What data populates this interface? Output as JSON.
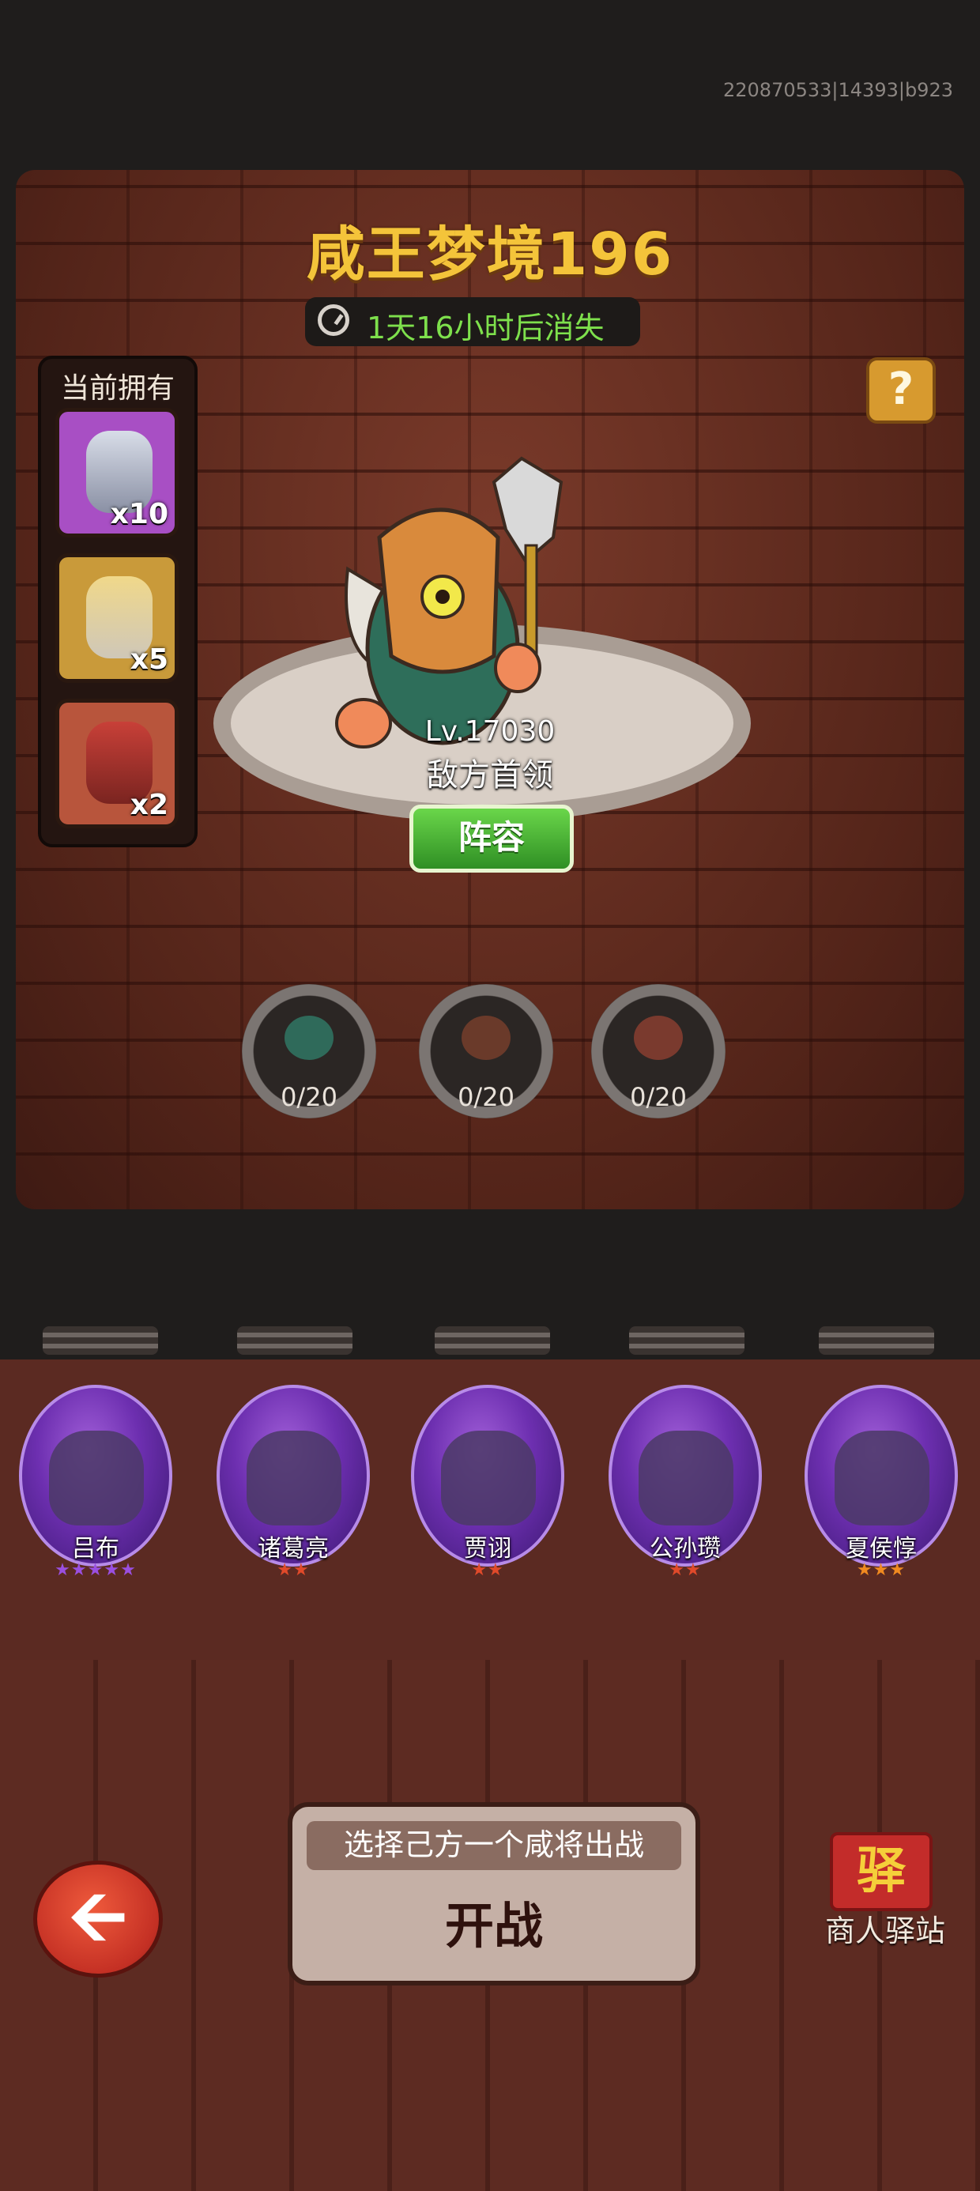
{
  "build_id": "220870533|14393|b923",
  "header": {
    "title": "咸王梦境196",
    "timer_text": "1天16小时后消失"
  },
  "help_label": "?",
  "inventory": {
    "label": "当前拥有",
    "items": [
      {
        "icon": "salt-shaker-icon",
        "qty": "x10",
        "color": "#a84fc4"
      },
      {
        "icon": "salt-sack-icon",
        "qty": "x5",
        "color": "#c99a3a"
      },
      {
        "icon": "salt-jar-icon",
        "qty": "x2",
        "color": "#b8553c"
      }
    ]
  },
  "boss": {
    "level": "Lv.17030",
    "title": "敌方首领",
    "lineup_label": "阵容"
  },
  "chambers": [
    {
      "icon": "fist-icon",
      "count": "0/20",
      "color": "#2f6a5a"
    },
    {
      "icon": "fist-icon",
      "count": "0/20",
      "color": "#6a3a2a"
    },
    {
      "icon": "fist-icon",
      "count": "0/20",
      "color": "#7a3a2e"
    }
  ],
  "heroes": [
    {
      "name": "吕布",
      "stars": 5,
      "star_color": "#9a4fe0"
    },
    {
      "name": "诸葛亮",
      "stars": 2,
      "star_color": "#e04a2a"
    },
    {
      "name": "贾诩",
      "stars": 2,
      "star_color": "#e04a2a"
    },
    {
      "name": "公孙瓒",
      "stars": 2,
      "star_color": "#e04a2a"
    },
    {
      "name": "夏侯惇",
      "stars": 3,
      "star_color": "#f08a20"
    }
  ],
  "battle": {
    "hint": "选择己方一个咸将出战",
    "button_label": "开战"
  },
  "back_label": "🡨",
  "merchant": {
    "flag_char": "驿",
    "label": "商人驿站"
  }
}
